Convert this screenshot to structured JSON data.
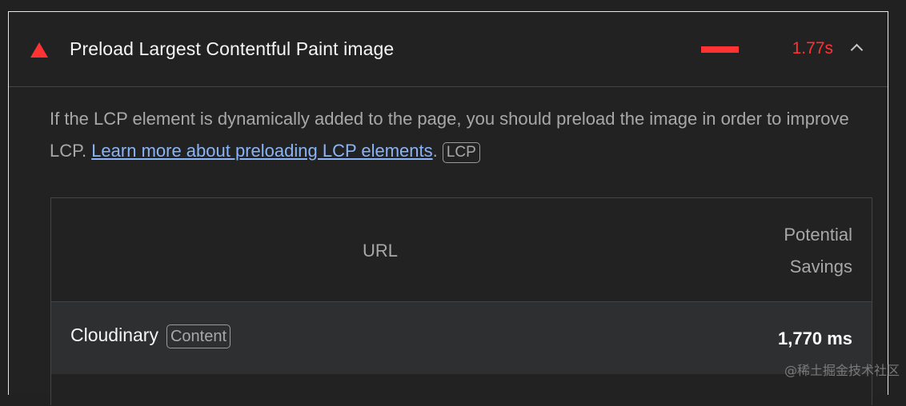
{
  "audit": {
    "title": "Preload Largest Contentful Paint image",
    "metric_value": "1.77s",
    "status_color": "#ff3333",
    "status_icon": "fail-triangle-icon",
    "expand_icon": "chevron-up-icon"
  },
  "description": {
    "text_before": "If the LCP element is dynamically added to the page, you should preload the image in order to improve LCP. ",
    "link_text": "Learn more about preloading LCP elements",
    "text_after": ". ",
    "tag": "LCP"
  },
  "table": {
    "columns": [
      "URL",
      "Potential Savings"
    ],
    "savings_header_lines": [
      "Potential",
      "Savings"
    ],
    "rows": [
      {
        "url": "Cloudinary",
        "tag": "Content",
        "savings": "1,770 ms"
      }
    ]
  },
  "watermark": "@稀土掘金技术社区"
}
